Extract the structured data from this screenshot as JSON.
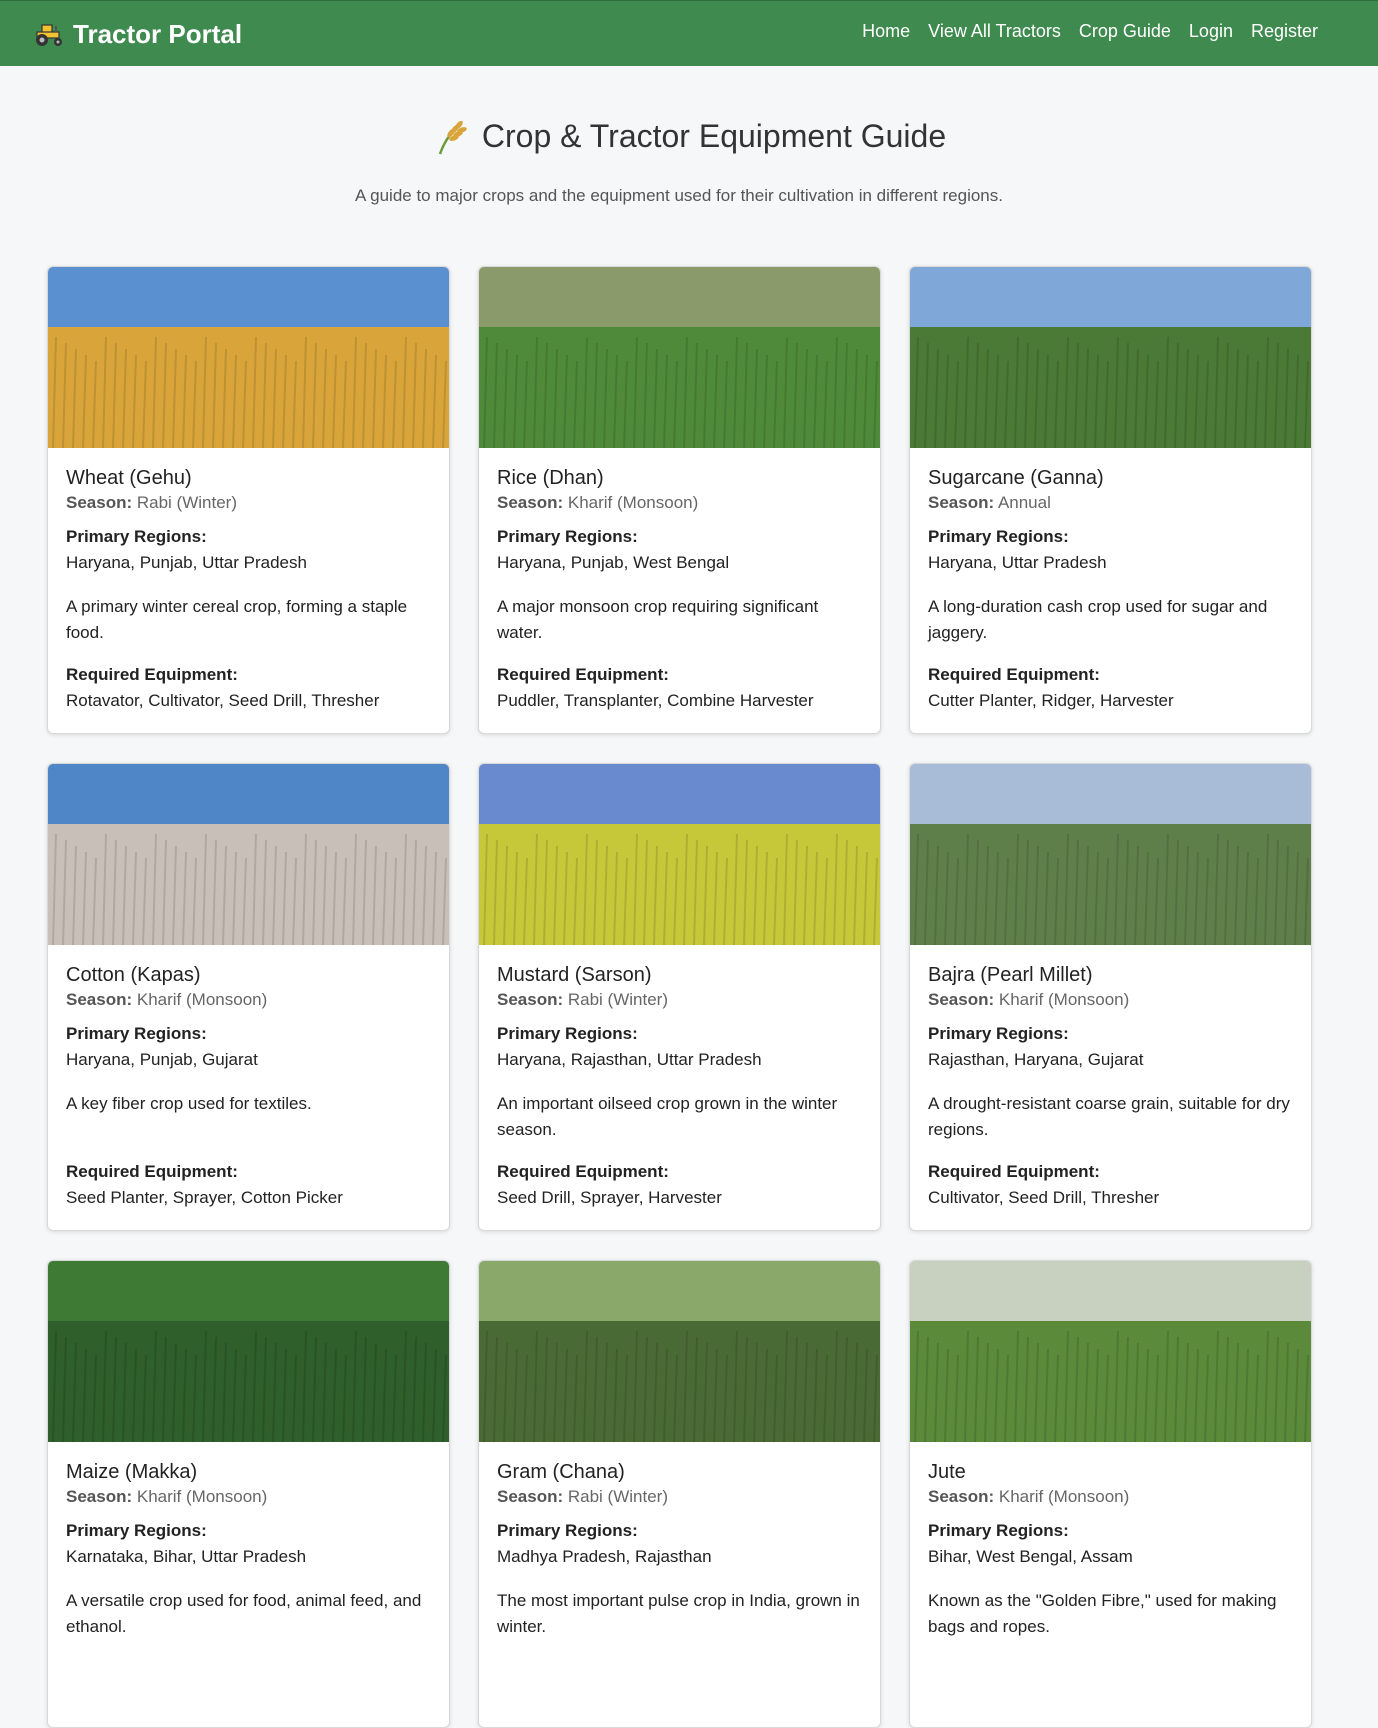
{
  "nav": {
    "brand": "Tractor Portal",
    "links": [
      "Home",
      "View All Tractors",
      "Crop Guide",
      "Login",
      "Register"
    ]
  },
  "header": {
    "title": "Crop & Tractor Equipment Guide",
    "subtitle": "A guide to major crops and the equipment used for their cultivation in different regions."
  },
  "labels": {
    "season": "Season:",
    "regions": "Primary Regions:",
    "equipment": "Required Equipment:"
  },
  "crops": [
    {
      "name": "Wheat (Gehu)",
      "season": "Rabi (Winter)",
      "regions": "Haryana, Punjab, Uttar Pradesh",
      "description": "A primary winter cereal crop, forming a staple food.",
      "equipment": "Rotavator, Cultivator, Seed Drill, Thresher"
    },
    {
      "name": "Rice (Dhan)",
      "season": "Kharif (Monsoon)",
      "regions": "Haryana, Punjab, West Bengal",
      "description": "A major monsoon crop requiring significant water.",
      "equipment": "Puddler, Transplanter, Combine Harvester"
    },
    {
      "name": "Sugarcane (Ganna)",
      "season": "Annual",
      "regions": "Haryana, Uttar Pradesh",
      "description": "A long-duration cash crop used for sugar and jaggery.",
      "equipment": "Cutter Planter, Ridger, Harvester"
    },
    {
      "name": "Cotton (Kapas)",
      "season": "Kharif (Monsoon)",
      "regions": "Haryana, Punjab, Gujarat",
      "description": "A key fiber crop used for textiles.",
      "equipment": "Seed Planter, Sprayer, Cotton Picker"
    },
    {
      "name": "Mustard (Sarson)",
      "season": "Rabi (Winter)",
      "regions": "Haryana, Rajasthan, Uttar Pradesh",
      "description": "An important oilseed crop grown in the winter season.",
      "equipment": "Seed Drill, Sprayer, Harvester"
    },
    {
      "name": "Bajra (Pearl Millet)",
      "season": "Kharif (Monsoon)",
      "regions": "Rajasthan, Haryana, Gujarat",
      "description": "A drought-resistant coarse grain, suitable for dry regions.",
      "equipment": "Cultivator, Seed Drill, Thresher"
    },
    {
      "name": "Maize (Makka)",
      "season": "Kharif (Monsoon)",
      "regions": "Karnataka, Bihar, Uttar Pradesh",
      "description": "A versatile crop used for food, animal feed, and ethanol.",
      "equipment": ""
    },
    {
      "name": "Gram (Chana)",
      "season": "Rabi (Winter)",
      "regions": "Madhya Pradesh, Rajasthan",
      "description": "The most important pulse crop in India, grown in winter.",
      "equipment": ""
    },
    {
      "name": "Jute",
      "season": "Kharif (Monsoon)",
      "regions": "Bihar, West Bengal, Assam",
      "description": "Known as the \"Golden Fibre,\" used for making bags and ropes.",
      "equipment": ""
    }
  ],
  "images": [
    {
      "icon": "wheat-field-image",
      "sky": "#5a8fd0",
      "ground": "#d9a53a"
    },
    {
      "icon": "rice-paddy-image",
      "sky": "#8a9a6a",
      "ground": "#4f8a3a"
    },
    {
      "icon": "sugarcane-field-image",
      "sky": "#7fa8d8",
      "ground": "#4a7a35"
    },
    {
      "icon": "cotton-plant-image",
      "sky": "#4f86c8",
      "ground": "#c8c0b8"
    },
    {
      "icon": "mustard-field-image",
      "sky": "#6a8ad0",
      "ground": "#c6c83a"
    },
    {
      "icon": "pearl-millet-image",
      "sky": "#a8bcd8",
      "ground": "#5f7f4a"
    },
    {
      "icon": "maize-field-image",
      "sky": "#3f7a35",
      "ground": "#2f5f2a"
    },
    {
      "icon": "gram-field-image",
      "sky": "#8aa86a",
      "ground": "#4a6a35"
    },
    {
      "icon": "jute-field-image",
      "sky": "#c8d0c0",
      "ground": "#5a8a3a"
    }
  ],
  "colors": {
    "navbar": "#3f8a4f",
    "page_bg": "#f5f7f8"
  }
}
